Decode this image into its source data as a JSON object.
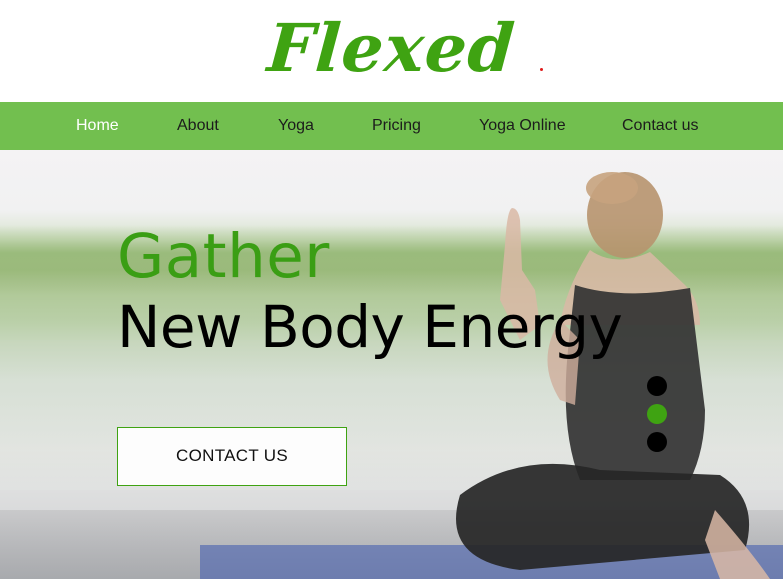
{
  "brand": {
    "logo_text": "Flexed",
    "logo_color": "#3fa312"
  },
  "nav": {
    "background": "#72bf4f",
    "items": [
      {
        "label": "Home",
        "active": true
      },
      {
        "label": "About",
        "active": false
      },
      {
        "label": "Yoga",
        "active": false
      },
      {
        "label": "Pricing",
        "active": false
      },
      {
        "label": "Yoga Online",
        "active": false
      },
      {
        "label": "Contact us",
        "active": false
      }
    ]
  },
  "hero": {
    "headline_accent": "Gather",
    "headline_main": "New Body Energy",
    "accent_color": "#3a9e14",
    "cta_label": "CONTACT US",
    "slider": {
      "slide_count": 3,
      "active_index": 1,
      "active_color": "#3fa312",
      "inactive_color": "#000000"
    }
  }
}
